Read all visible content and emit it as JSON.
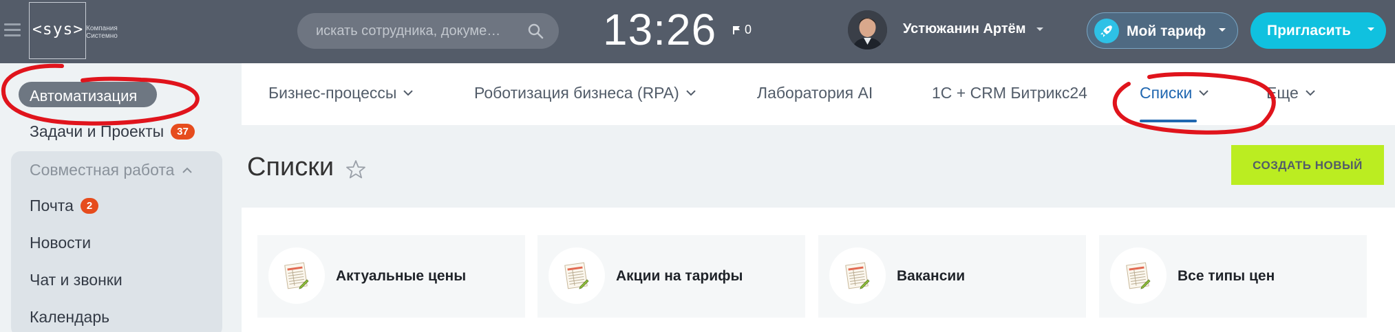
{
  "header": {
    "logo": {
      "main": "<sys>",
      "sub_line1": "Компания",
      "sub_line2": "Системно"
    },
    "search": {
      "placeholder": "искать сотрудника, докуме…"
    },
    "clock": "13:26",
    "flag_count": "0",
    "user": {
      "name": "Устюжанин Артём"
    },
    "tariff_label": "Мой тариф",
    "invite_label": "Пригласить"
  },
  "sidebar": {
    "active_item": "Автоматизация",
    "items": [
      {
        "label": "Задачи и Проекты",
        "badge": "37"
      }
    ],
    "group": {
      "title": "Совместная работа",
      "items": [
        {
          "label": "Почта",
          "badge": "2"
        },
        {
          "label": "Новости"
        },
        {
          "label": "Чат и звонки"
        },
        {
          "label": "Календарь"
        }
      ]
    }
  },
  "topnav": {
    "tabs": [
      {
        "label": "Бизнес-процессы"
      },
      {
        "label": "Роботизация бизнеса (RPA)"
      },
      {
        "label": "Лаборатория AI"
      },
      {
        "label": "1С + CRM Битрикс24"
      },
      {
        "label": "Списки"
      },
      {
        "label": "Еще"
      }
    ]
  },
  "page": {
    "title": "Списки",
    "create_button": "СОЗДАТЬ НОВЫЙ",
    "cards": [
      {
        "label": "Актуальные цены"
      },
      {
        "label": "Акции на тарифы"
      },
      {
        "label": "Вакансии"
      },
      {
        "label": "Все типы цен"
      }
    ]
  },
  "colors": {
    "header_bg": "#545c69",
    "accent_blue": "#2067b0",
    "invite_bg": "#10c1df",
    "create_bg": "#bbed21",
    "badge_red": "#e64c1d",
    "annotation_red": "#e0141c"
  }
}
